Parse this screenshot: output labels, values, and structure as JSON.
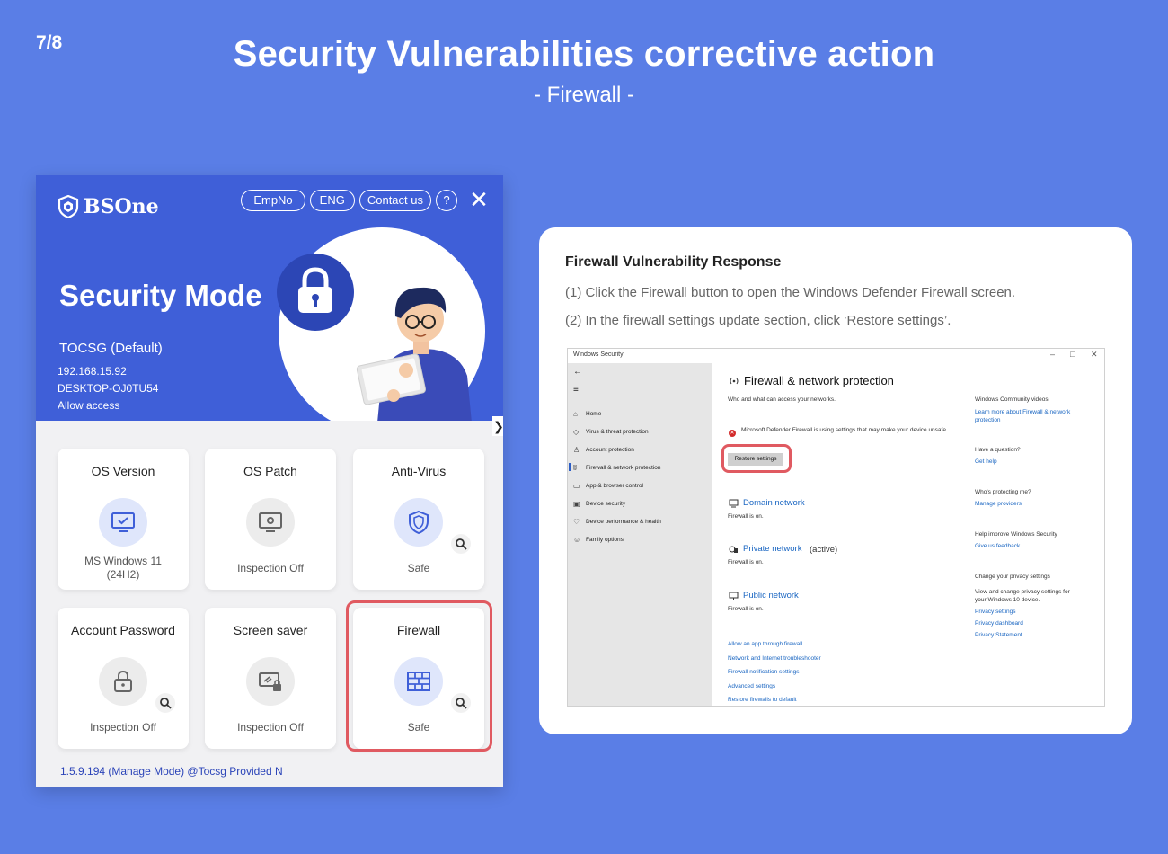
{
  "slide": {
    "page_number": "7/8",
    "title": "Security Vulnerabilities corrective action",
    "subtitle": "- Firewall -"
  },
  "app": {
    "logo": "BSOne",
    "header_buttons": {
      "empno": "EmpNo",
      "language": "ENG",
      "contact": "Contact us",
      "help": "?",
      "close": "✕"
    },
    "mode_title": "Security Mode",
    "profile": "TOCSG (Default)",
    "ip": "192.168.15.92",
    "hostname": "DESKTOP-OJ0TU54",
    "access": "Allow access",
    "expand_arrow": "❯",
    "cards": [
      {
        "title": "OS Version",
        "status": "MS Windows 11\n(24H2)",
        "icon": "monitor-check-icon"
      },
      {
        "title": "OS Patch",
        "status": "Inspection Off",
        "icon": "monitor-gear-icon"
      },
      {
        "title": "Anti-Virus",
        "status": "Safe",
        "icon": "shield-icon"
      },
      {
        "title": "Account Password",
        "status": "Inspection Off",
        "icon": "lock-icon"
      },
      {
        "title": "Screen saver",
        "status": "Inspection Off",
        "icon": "screen-lock-icon"
      },
      {
        "title": "Firewall",
        "status": "Safe",
        "icon": "firewall-brick-icon"
      }
    ],
    "footer": "1.5.9.194 (Manage Mode) @Tocsg Provided N"
  },
  "response": {
    "title": "Firewall Vulnerability Response",
    "step1": "(1) Click the Firewall button to open the Windows Defender Firewall screen.",
    "step2": "(2) In the firewall settings update section, click ‘Restore settings’."
  },
  "windows_security": {
    "window_title": "Windows Security",
    "controls": {
      "minimize": "–",
      "maximize": "□",
      "close": "✕"
    },
    "nav": {
      "back": "←",
      "menu": "≡",
      "items": [
        "Home",
        "Virus & threat protection",
        "Account protection",
        "Firewall & network protection",
        "App & browser control",
        "Device security",
        "Device performance & health",
        "Family options"
      ]
    },
    "heading": "Firewall & network protection",
    "heading_sub": "Who and what can access your networks.",
    "warning": "Microsoft Defender Firewall is using settings that may make your device unsafe.",
    "restore_button": "Restore settings",
    "networks": [
      {
        "name": "Domain network",
        "suffix": "",
        "status": "Firewall is on."
      },
      {
        "name": "Private network",
        "suffix": "(active)",
        "status": "Firewall is on."
      },
      {
        "name": "Public network",
        "suffix": "",
        "status": "Firewall is on."
      }
    ],
    "links": [
      "Allow an app through firewall",
      "Network and Internet troubleshooter",
      "Firewall notification settings",
      "Advanced settings",
      "Restore firewalls to default"
    ],
    "right": {
      "videos_title": "Windows Community videos",
      "videos_link": "Learn more about Firewall & network protection",
      "question_title": "Have a question?",
      "question_link": "Get help",
      "protect_title": "Who's protecting me?",
      "protect_link": "Manage providers",
      "improve_title": "Help improve Windows Security",
      "improve_link": "Give us feedback",
      "privacy_title": "Change your privacy settings",
      "privacy_text": "View and change privacy settings for your Windows 10 device.",
      "privacy_links": [
        "Privacy settings",
        "Privacy dashboard",
        "Privacy Statement"
      ]
    }
  },
  "colors": {
    "background": "#5a7ee6",
    "app_header": "#3f5fd8",
    "highlight": "#e05a61",
    "link": "#1a66c2"
  }
}
